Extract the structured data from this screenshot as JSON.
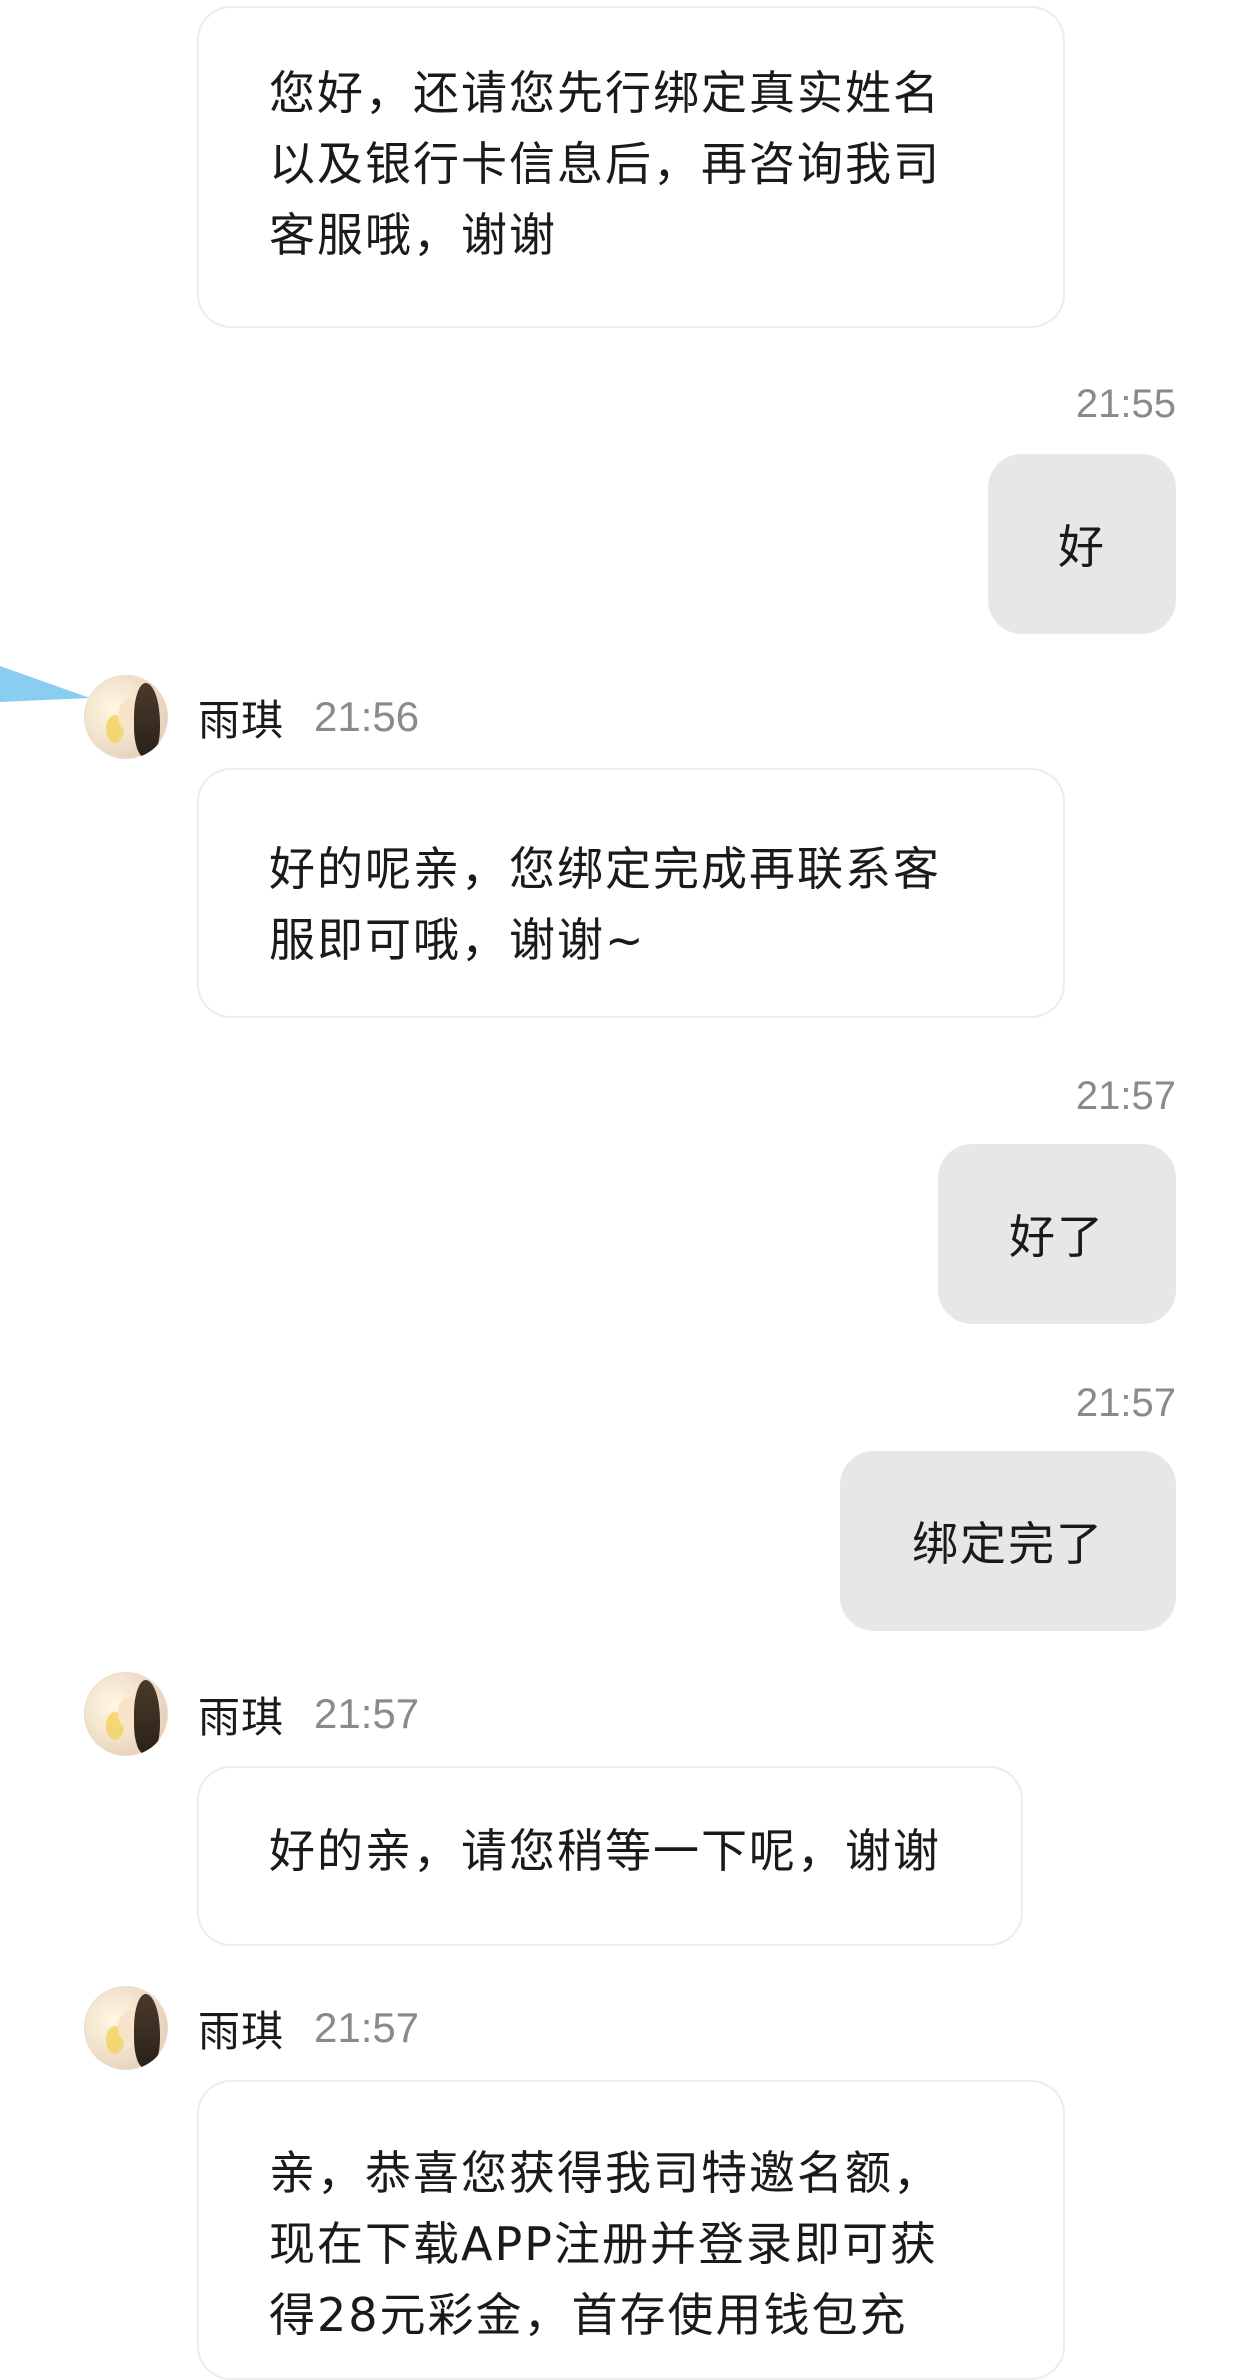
{
  "messages": {
    "m1": {
      "text": "您好，还请您先行绑定真实姓名\n以及银行卡信息后，再咨询我司\n客服哦，谢谢"
    },
    "m2": {
      "time": "21:55",
      "text": "好"
    },
    "m3": {
      "sender": "雨琪",
      "time": "21:56",
      "text": "好的呢亲，您绑定完成再联系客\n服即可哦，谢谢~"
    },
    "m4": {
      "time": "21:57",
      "text": "好了"
    },
    "m5": {
      "time": "21:57",
      "text": "绑定完了"
    },
    "m6": {
      "sender": "雨琪",
      "time": "21:57",
      "text": "好的亲，请您稍等一下呢，谢谢"
    },
    "m7": {
      "sender": "雨琪",
      "time": "21:57",
      "text": "亲，恭喜您获得我司特邀名额，\n现在下载APP注册并登录即可获\n得28元彩金，首存使用钱包充"
    }
  },
  "colors": {
    "incoming_bubble": "#ffffff",
    "outgoing_bubble": "#e7e7e7",
    "timestamp": "#8a8a8a"
  }
}
